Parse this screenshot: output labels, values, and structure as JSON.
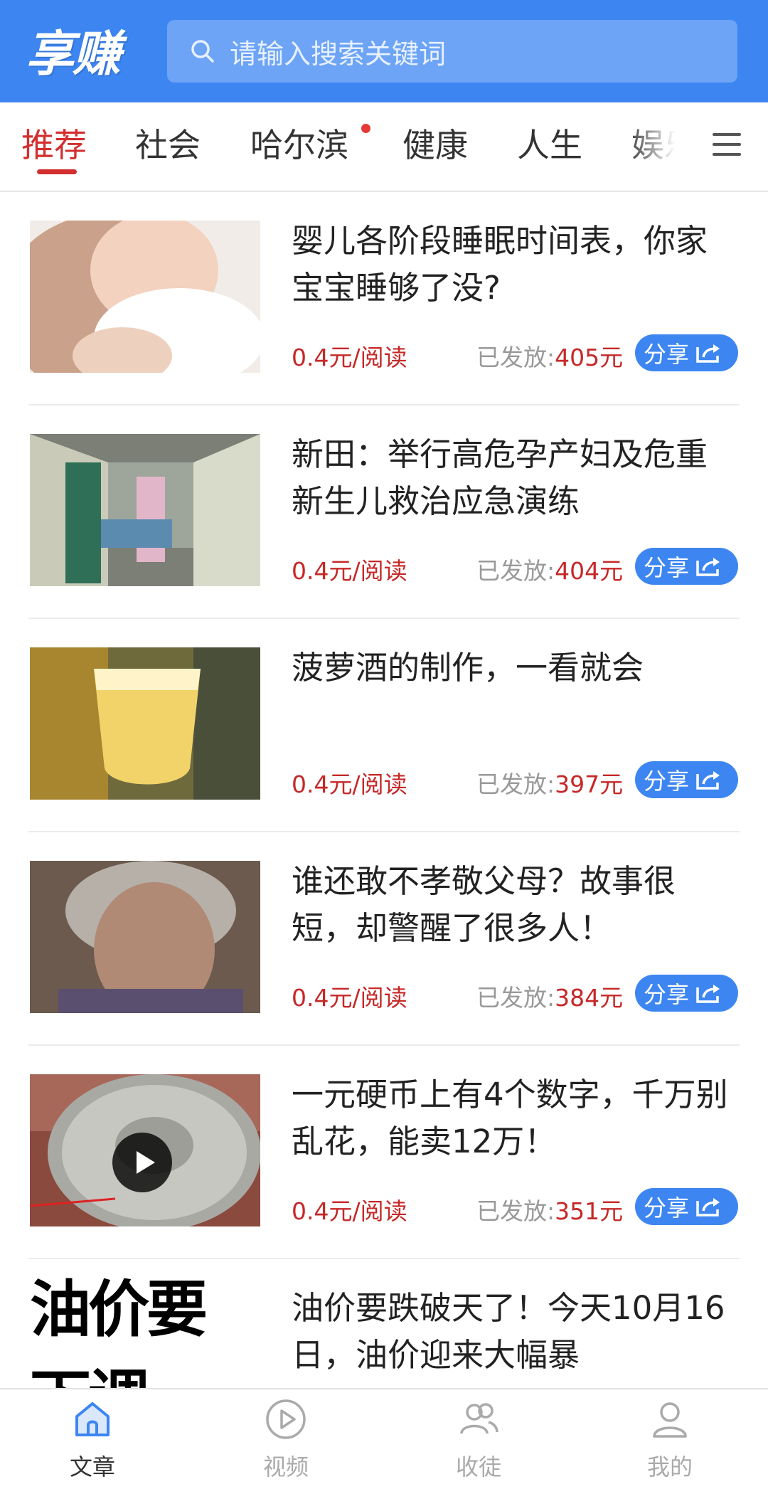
{
  "header": {
    "logo": "享赚",
    "search_placeholder": "请输入搜索关键词"
  },
  "tabs": [
    {
      "label": "推荐",
      "active": true
    },
    {
      "label": "社会"
    },
    {
      "label": "哈尔滨",
      "dot": true
    },
    {
      "label": "健康"
    },
    {
      "label": "人生"
    },
    {
      "label": "娱乐"
    }
  ],
  "articles": [
    {
      "title": "婴儿各阶段睡眠时间表，你家宝宝睡够了没?",
      "price": "0.4元/阅读",
      "paid_label": "已发放:",
      "paid_amount": "405元",
      "share": "分享"
    },
    {
      "title": "新田：举行高危孕产妇及危重新生儿救治应急演练",
      "price": "0.4元/阅读",
      "paid_label": "已发放:",
      "paid_amount": "404元",
      "share": "分享"
    },
    {
      "title": "菠萝酒的制作，一看就会",
      "price": "0.4元/阅读",
      "paid_label": "已发放:",
      "paid_amount": "397元",
      "share": "分享"
    },
    {
      "title": "谁还敢不孝敬父母？故事很短，却警醒了很多人！",
      "price": "0.4元/阅读",
      "paid_label": "已发放:",
      "paid_amount": "384元",
      "share": "分享"
    },
    {
      "title": "一元硬币上有4个数字，千万别乱花，能卖12万！",
      "price": "0.4元/阅读",
      "paid_label": "已发放:",
      "paid_amount": "351元",
      "share": "分享",
      "video": true
    },
    {
      "title": "油价要跌破天了！今天10月16日，油价迎来大幅暴",
      "thumb_text": "油价要下调"
    }
  ],
  "bottom_nav": [
    {
      "label": "文章",
      "icon": "home-icon",
      "active": true
    },
    {
      "label": "视频",
      "icon": "play-circle-icon"
    },
    {
      "label": "收徒",
      "icon": "users-icon"
    },
    {
      "label": "我的",
      "icon": "user-icon"
    }
  ],
  "colors": {
    "brand_blue": "#3d86f2",
    "accent_red": "#d32f2f"
  }
}
